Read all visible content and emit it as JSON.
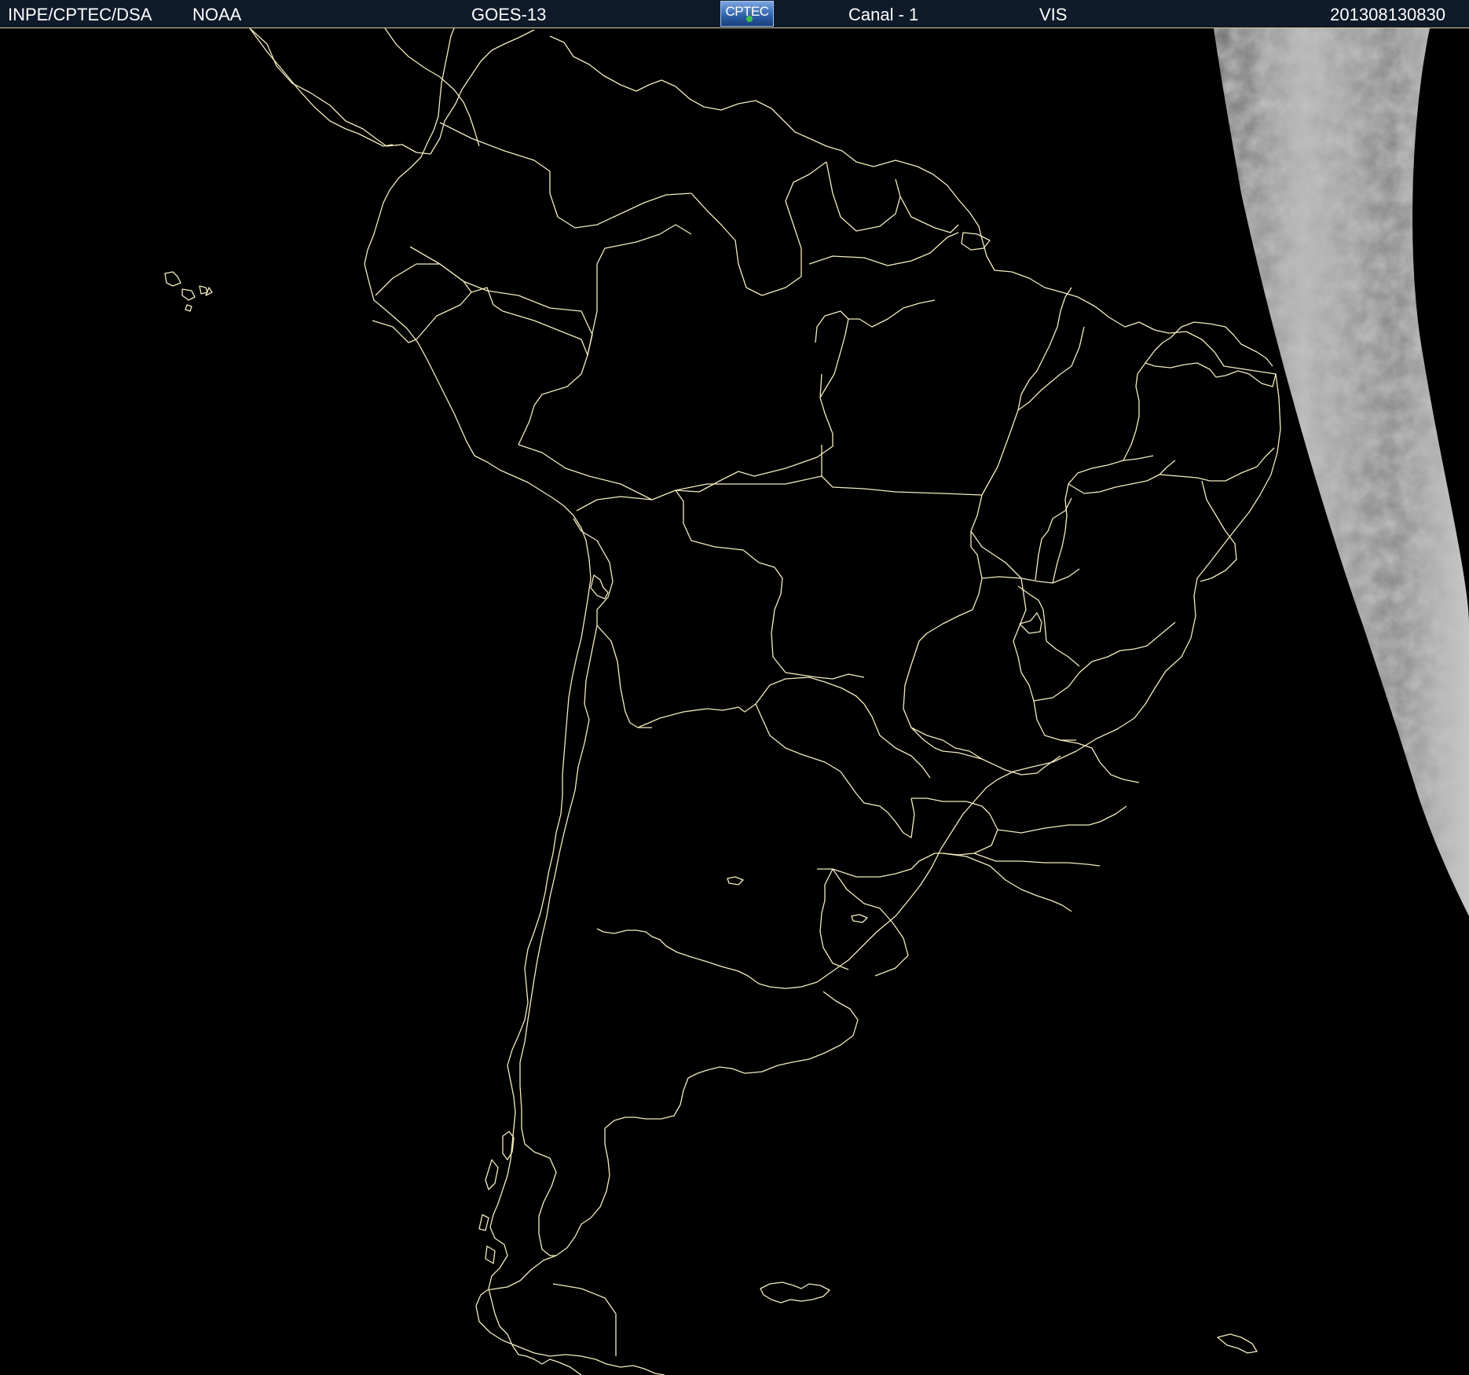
{
  "header": {
    "organization": "INPE/CPTEC/DSA",
    "agency": "NOAA",
    "satellite": "GOES-13",
    "logo_text": "CPTEC",
    "channel": "Canal - 1",
    "band": "VIS",
    "timestamp": "201308130830"
  },
  "colors": {
    "background": "#000000",
    "boundary_lines": "#f2ecc0",
    "header_bar": "#0f1a2a",
    "cloud_band": "#9a9a9a"
  },
  "map": {
    "projection_view": "South America satellite image",
    "illuminated_region": "daylight terminator band on east edge"
  }
}
